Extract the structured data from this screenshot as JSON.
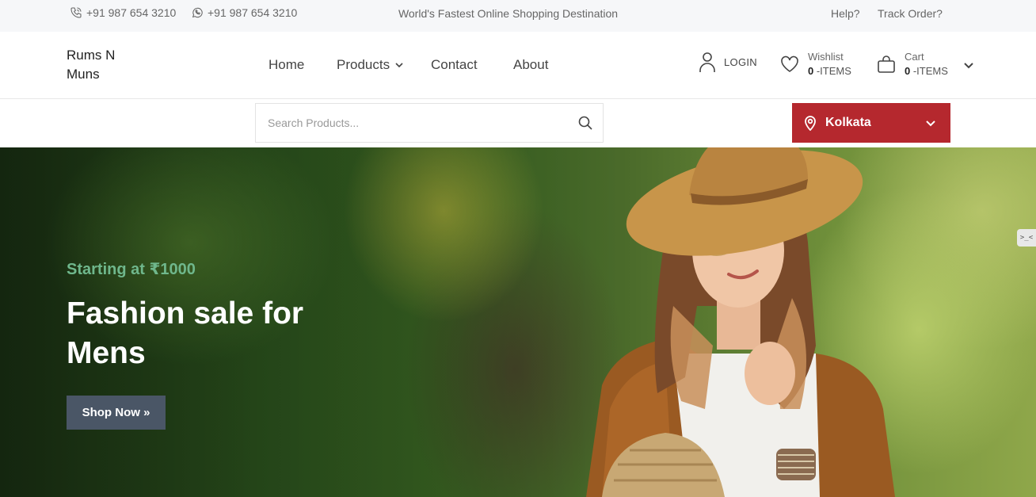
{
  "topbar": {
    "phone_1": "+91 987 654 3210",
    "phone_2": "+91 987 654 3210",
    "tagline": "World's Fastest Online Shopping Destination",
    "help": "Help?",
    "track_order": "Track Order?"
  },
  "header": {
    "logo_line1": "Rums N",
    "logo_line2": "Muns",
    "nav": {
      "home": "Home",
      "products": "Products",
      "contact": "Contact",
      "about": "About"
    },
    "login": "LOGIN",
    "wishlist": {
      "label": "Wishlist",
      "count": "0",
      "suffix": " -ITEMS"
    },
    "cart": {
      "label": "Cart",
      "count": "0",
      "suffix": " -ITEMS"
    }
  },
  "search": {
    "placeholder": "Search Products..."
  },
  "location": {
    "city": "Kolkata"
  },
  "hero": {
    "subtitle": "Starting at ₹1000",
    "title": "Fashion sale for Mens",
    "button": "Shop Now »"
  },
  "side_tab": ">_<",
  "colors": {
    "accent_red": "#b5282e",
    "hero_subtitle_green": "#6fb78c",
    "button_slate": "#4a5666"
  },
  "icons": [
    "phone-icon",
    "whatsapp-icon",
    "user-icon",
    "heart-icon",
    "bag-icon",
    "chevron-down-icon",
    "search-icon",
    "map-pin-icon"
  ]
}
